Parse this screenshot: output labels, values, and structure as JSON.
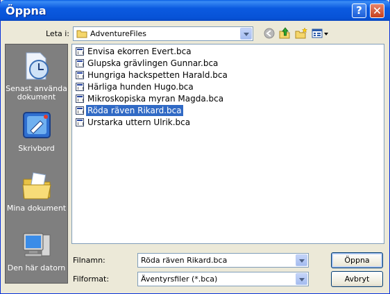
{
  "window": {
    "title": "Öppna"
  },
  "title_buttons": {
    "help": "?",
    "close": "✕"
  },
  "look_in": {
    "label": "Leta i:",
    "value": "AdventureFiles"
  },
  "toolbar": {
    "icons": [
      "back-icon",
      "up-folder-icon",
      "new-folder-icon",
      "view-menu-icon"
    ]
  },
  "places": [
    {
      "label": "Senast använda dokument",
      "icon": "recent-documents-icon"
    },
    {
      "label": "Skrivbord",
      "icon": "desktop-icon"
    },
    {
      "label": "Mina dokument",
      "icon": "my-documents-icon"
    },
    {
      "label": "Den här datorn",
      "icon": "my-computer-icon"
    }
  ],
  "files": [
    {
      "name": "Envisa ekorren Evert.bca"
    },
    {
      "name": "Glupska grävlingen Gunnar.bca"
    },
    {
      "name": "Hungriga hackspetten Harald.bca"
    },
    {
      "name": "Härliga hunden Hugo.bca"
    },
    {
      "name": "Mikroskopiska myran Magda.bca"
    },
    {
      "name": "Röda räven Rikard.bca",
      "selected": true
    },
    {
      "name": "Urstarka uttern Ulrik.bca"
    }
  ],
  "filename": {
    "label": "Filnamn:",
    "value": "Röda räven Rikard.bca"
  },
  "filetype": {
    "label": "Filformat:",
    "value": "Äventyrsfiler (*.bca)"
  },
  "buttons": {
    "open": "Öppna",
    "cancel": "Avbryt"
  },
  "colors": {
    "titlebar": "#0a5fe4",
    "selection": "#316ac5",
    "places_bg": "#7f7f7f"
  }
}
